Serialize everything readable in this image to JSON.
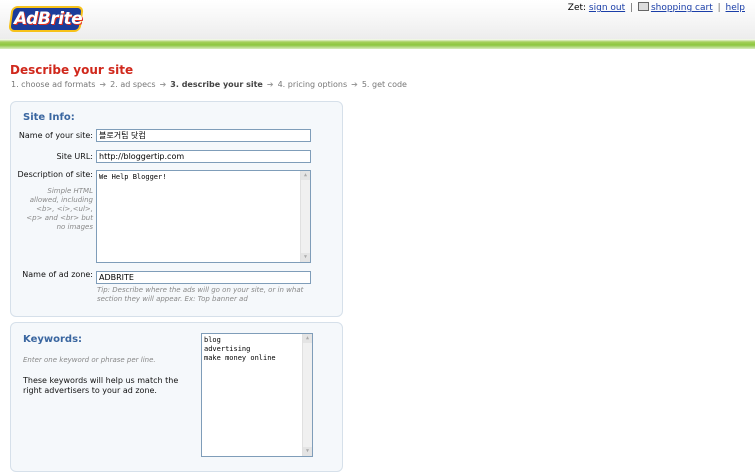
{
  "brand": {
    "logo_text": "AdBrite"
  },
  "usernav": {
    "user": "Zet:",
    "sign_out": "sign out",
    "shopping_cart": "shopping cart",
    "help": "help",
    "sep": "|"
  },
  "page": {
    "title": "Describe your site"
  },
  "steps": {
    "s1": "1. choose ad formats",
    "s2": "2. ad specs",
    "s3": "3. describe your site",
    "s4": "4. pricing options",
    "s5": "5. get code",
    "arrow": "➔"
  },
  "site_info": {
    "title": "Site Info:",
    "name_label": "Name of your site:",
    "name_value": "블로거팁 닷컴",
    "url_label": "Site URL:",
    "url_value": "http://bloggertip.com",
    "desc_label": "Description of site:",
    "desc_hint": "Simple HTML allowed, including <b>, <i>,<ul>, <p> and <br> but no images",
    "desc_value": "We Help Blogger!",
    "zone_label": "Name of ad zone:",
    "zone_value": "ADBRITE",
    "zone_tip": "Tip: Describe where the ads will go on your site, or in what section they will appear. Ex: Top banner ad"
  },
  "keywords": {
    "title": "Keywords:",
    "note": "Enter one keyword or phrase per line.",
    "help": "These keywords will help us match the right advertisers to your ad zone.",
    "value": "blog\nadvertising\nmake money online"
  },
  "colors": {
    "accent_red": "#d0281c",
    "panel_title": "#3a66a0",
    "green_bar": "#8cc63f"
  }
}
